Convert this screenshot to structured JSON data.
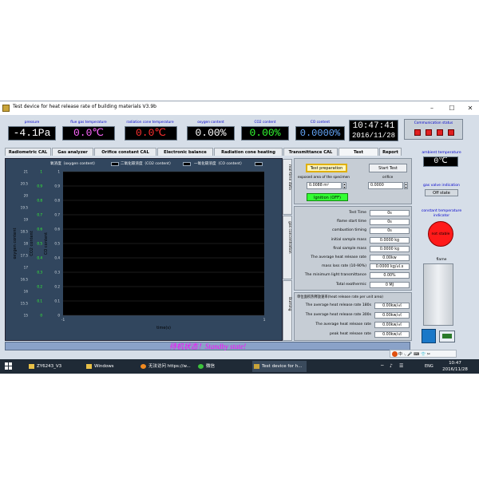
{
  "window": {
    "title": "Test device for heat release rate of building materials V3.9b",
    "minimize": "–",
    "maximize": "☐",
    "close": "✕"
  },
  "readouts": [
    {
      "label": "pressure",
      "value": "-4.1Pa",
      "color": "#ffffff"
    },
    {
      "label": "flue gas temperature",
      "value": "0.0℃",
      "color": "#ff66ff"
    },
    {
      "label": "radiation cone temperature",
      "value": "0.0℃",
      "color": "#ff3030"
    },
    {
      "label": "oxygen content",
      "value": "0.00%",
      "color": "#ffffff"
    },
    {
      "label": "CO2 content",
      "value": "0.00%",
      "color": "#33ff33"
    },
    {
      "label": "CO content",
      "value": "0.0000%",
      "color": "#66aaff"
    }
  ],
  "clock": {
    "time": "10:47:41",
    "date": "2016/11/28"
  },
  "comm_status": {
    "label": "Communication status"
  },
  "tabs": [
    "Radiometric CAL",
    "Gas analyzer",
    "Orifice constant CAL",
    "Electronic balance",
    "Radiation cone heating",
    "Transmittance CAL",
    "Test",
    "Report"
  ],
  "active_tab": "Test",
  "chart_data": {
    "type": "line",
    "legend": [
      "氧浓度（oxygen content）",
      "二氧化碳浓度（CO2 content）",
      "一氧化碳浓度（CO content）"
    ],
    "xlabel": "time(s)",
    "x_ticks": [
      "-1",
      "1"
    ],
    "xlim": [
      -1,
      1
    ],
    "ylabel_left": "oxygen content",
    "ylabel_left2": "CO2 content",
    "ylabel_right": "CO content",
    "o2_ticks": [
      "21",
      "20.5",
      "20",
      "19.5",
      "19",
      "18.5",
      "18",
      "17.5",
      "17",
      "16.5",
      "16",
      "15.5",
      "15"
    ],
    "co2_ticks": [
      "1",
      "0.9",
      "0.8",
      "0.7",
      "0.6",
      "0.5",
      "0.4",
      "0.3",
      "0.2",
      "0.1",
      "0"
    ],
    "series": [
      {
        "name": "氧浓度（oxygen content）",
        "values": []
      },
      {
        "name": "二氧化碳浓度（CO2 content）",
        "values": []
      },
      {
        "name": "一氧化碳浓度（CO content）",
        "values": []
      }
    ],
    "grid": true
  },
  "side_tabs": [
    "real-time data",
    "gas concentration",
    "Burning"
  ],
  "test": {
    "prep_button": "Test preparation",
    "start_button": "Start Test",
    "area_label": "exposed area of the specimen",
    "area_value": "0.0088 m²",
    "orifice_label": "orifice",
    "orifice_value": "0.0000",
    "ignition_button": "Ignition (OFF)"
  },
  "results": [
    {
      "label": "Test Time",
      "value": "0s"
    },
    {
      "label": "flame start time",
      "value": "0s"
    },
    {
      "label": "combustion timing",
      "value": "0s"
    },
    {
      "label": "initial sample mass",
      "value": "0.0000 kg"
    },
    {
      "label": "final sample mass",
      "value": "0.0000 kg"
    },
    {
      "label": "The average heat release rate",
      "value": "0.00kw"
    },
    {
      "label": "mass loss rate (10-90%)",
      "value": "0.0000 kg/㎡.s"
    },
    {
      "label": "The minimum light transmittance",
      "value": "0.00%"
    },
    {
      "label": "Total exothermic",
      "value": "0 MJ"
    }
  ],
  "unit_area": {
    "title": "单位面积热释放速率(heat release rate per unit area)",
    "rows": [
      {
        "label": "The average heat release rate 180s",
        "value": "0.00kw/㎡"
      },
      {
        "label": "The average heat release rate 300s",
        "value": "0.00kw/㎡"
      },
      {
        "label": "The average heat release rate",
        "value": "0.00kw/㎡"
      },
      {
        "label": "peak heat release rate",
        "value": "0.00kw/㎡"
      }
    ]
  },
  "right_column": {
    "ambient_label": "ambient temperature",
    "ambient_value": "0℃",
    "gas_valve_label": "gas valve indication",
    "gas_valve_value": "Off state",
    "const_temp_label": "constant temperature indicator",
    "const_temp_value": "not stable",
    "flame_label": "flame"
  },
  "status_bar": {
    "text": "待机状态！Standby state!"
  },
  "ime": {
    "text": "中 ·, 🎤 ⌨ 👕 ✂"
  },
  "taskbar": {
    "items": [
      "ZY6243_V3",
      "Windows",
      "无法访问 https://w...",
      "微信",
      "Test device for h..."
    ],
    "tray_lang": "ENG",
    "tray_time": "10:47",
    "tray_date": "2016/11/28"
  }
}
